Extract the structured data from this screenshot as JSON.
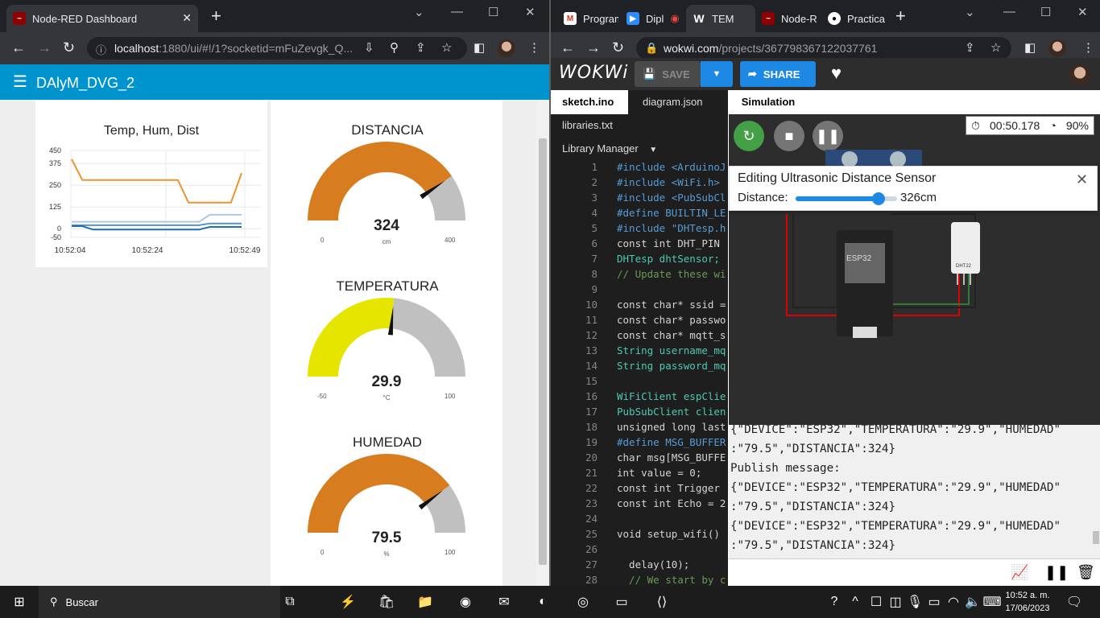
{
  "left_browser": {
    "tab_title": "Node-RED Dashboard",
    "url_host": "localhost",
    "url_rest": ":1880/ui/#!/1?socketid=mFuZevgk_Q...",
    "header_title": "DAlyM_DVG_2",
    "chart": {
      "title": "Temp, Hum, Dist",
      "y_ticks": [
        "450",
        "375",
        "250",
        "125",
        "0",
        "-50"
      ],
      "x_ticks": [
        "10:52:04",
        "10:52:24",
        "10:52:49"
      ]
    },
    "gauges": [
      {
        "title": "DISTANCIA",
        "value": "324",
        "unit": "cm",
        "min": "0",
        "max": "400",
        "level": 0.81,
        "color": "#d77c1f"
      },
      {
        "title": "TEMPERATURA",
        "value": "29.9",
        "unit": "°C",
        "min": "-50",
        "max": "100",
        "level": 0.53,
        "color": "#e5e500"
      },
      {
        "title": "HUMEDAD",
        "value": "79.5",
        "unit": "%",
        "min": "0",
        "max": "100",
        "level": 0.795,
        "color": "#d77c1f"
      }
    ]
  },
  "chart_data": {
    "type": "line",
    "title": "Temp, Hum, Dist",
    "x_ticks": [
      "10:52:04",
      "10:52:24",
      "10:52:49"
    ],
    "ylim": [
      -50,
      450
    ],
    "series": [
      {
        "values": [
          400,
          280,
          280,
          280,
          280,
          280,
          280,
          280,
          280,
          280,
          280,
          150,
          150,
          150,
          150,
          150,
          320
        ],
        "color": "#f0922a"
      },
      {
        "values": [
          40,
          40,
          40,
          40,
          40,
          40,
          40,
          40,
          40,
          40,
          40,
          40,
          40,
          80,
          80,
          80,
          80
        ],
        "color": "#aec7e8"
      },
      {
        "values": [
          20,
          20,
          20,
          20,
          20,
          20,
          20,
          20,
          20,
          20,
          20,
          20,
          20,
          30,
          30,
          30,
          30
        ],
        "color": "#5b93c9"
      },
      {
        "values": [
          15,
          15,
          -5,
          -5,
          -5,
          -5,
          -5,
          -5,
          -5,
          -5,
          -5,
          -5,
          -5,
          10,
          10,
          10,
          10
        ],
        "color": "#1f6fb2"
      }
    ]
  },
  "right_browser": {
    "tabs": [
      "Program",
      "Dipl",
      "TEM",
      "Node-R",
      "Practica"
    ],
    "url_host": "wokwi.com",
    "url_rest": "/projects/367798367122037761",
    "logo": "WOKWi",
    "save_label": "SAVE",
    "share_label": "SHARE",
    "editor_tabs": [
      "sketch.ino",
      "diagram.json",
      "libraries.txt",
      "Library Manager"
    ],
    "sim_tab": "Simulation",
    "timer": "00:50.178",
    "speed": "90%",
    "edit_title": "Editing Ultrasonic Distance Sensor",
    "distance_label": "Distance:",
    "distance_value": "326cm",
    "distance_level": 0.815,
    "chip_label": "ESP32",
    "dht_label": "DHT22",
    "serial": [
      "{\"DEVICE\":\"ESP32\",\"TEMPERATURA\":\"29.9\",\"HUMEDAD\"",
      ":\"79.5\",\"DISTANCIA\":324}",
      "Publish message:",
      "{\"DEVICE\":\"ESP32\",\"TEMPERATURA\":\"29.9\",\"HUMEDAD\"",
      ":\"79.5\",\"DISTANCIA\":324}",
      "{\"DEVICE\":\"ESP32\",\"TEMPERATURA\":\"29.9\",\"HUMEDAD\"",
      ":\"79.5\",\"DISTANCIA\":324}"
    ],
    "code": [
      [
        "1",
        "#include <ArduinoJ"
      ],
      [
        "2",
        "#include <WiFi.h>"
      ],
      [
        "3",
        "#include <PubSubCl"
      ],
      [
        "4",
        "#define BUILTIN_LE"
      ],
      [
        "5",
        "#include \"DHTesp.h"
      ],
      [
        "6",
        "const int DHT_PIN"
      ],
      [
        "7",
        "DHTesp dhtSensor;"
      ],
      [
        "8",
        "// Update these wi"
      ],
      [
        "9",
        ""
      ],
      [
        "10",
        "const char* ssid ="
      ],
      [
        "11",
        "const char* passwo"
      ],
      [
        "12",
        "const char* mqtt_s"
      ],
      [
        "13",
        "String username_mq"
      ],
      [
        "14",
        "String password_mq"
      ],
      [
        "15",
        ""
      ],
      [
        "16",
        "WiFiClient espClie"
      ],
      [
        "17",
        "PubSubClient clien"
      ],
      [
        "18",
        "unsigned long last"
      ],
      [
        "19",
        "#define MSG_BUFFER"
      ],
      [
        "20",
        "char msg[MSG_BUFFE"
      ],
      [
        "21",
        "int value = 0;"
      ],
      [
        "22",
        "const int Trigger"
      ],
      [
        "23",
        "const int Echo = 2"
      ],
      [
        "24",
        ""
      ],
      [
        "25",
        "void setup_wifi()"
      ],
      [
        "26",
        ""
      ],
      [
        "27",
        "  delay(10);"
      ],
      [
        "28",
        "  // We start by c"
      ]
    ]
  },
  "taskbar": {
    "search": "Buscar",
    "time": "10:52 a. m.",
    "date": "17/06/2023"
  }
}
